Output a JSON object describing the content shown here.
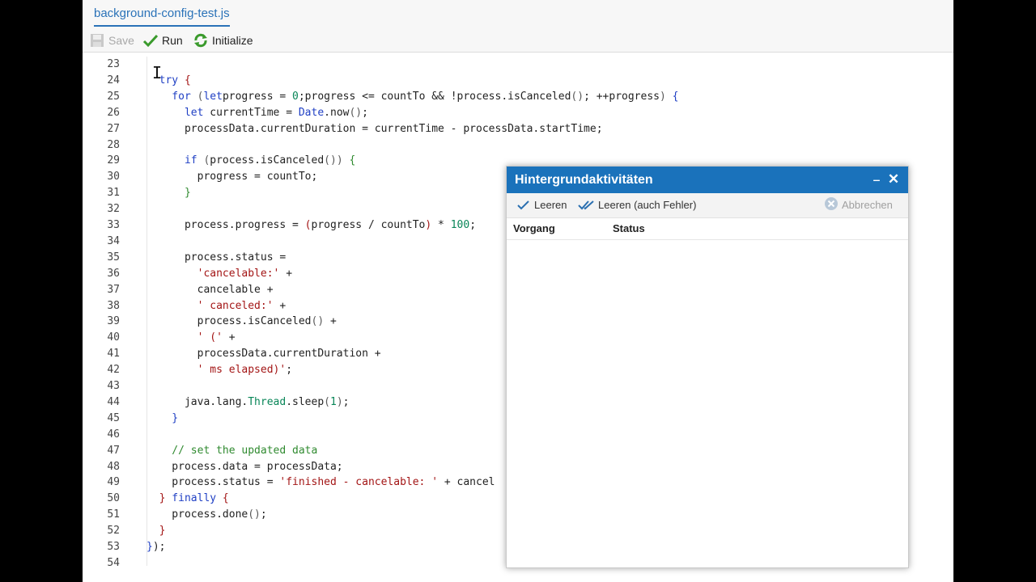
{
  "editor": {
    "tab_label": "background-config-test.js",
    "toolbar": {
      "save_label": "Save",
      "run_label": "Run",
      "initialize_label": "Initialize"
    },
    "lines": [
      {
        "no": "23",
        "segs": []
      },
      {
        "no": "24",
        "segs": [
          [
            "kw",
            "  try"
          ],
          [
            "brace",
            " {"
          ]
        ]
      },
      {
        "no": "25",
        "segs": [
          [
            "kw",
            "    for"
          ],
          [
            "pn",
            " ("
          ],
          [
            "kw",
            "let"
          ],
          [
            "",
            "progress = "
          ],
          [
            "num",
            "0"
          ],
          [
            "",
            ";progress <= countTo && !process.isCanceled"
          ],
          [
            "pn",
            "()"
          ],
          [
            "",
            "; ++progress"
          ],
          [
            "pn",
            ")"
          ],
          [
            "kw",
            " {"
          ]
        ]
      },
      {
        "no": "26",
        "segs": [
          [
            "kw",
            "      let"
          ],
          [
            "",
            " currentTime = "
          ],
          [
            "fn",
            "Date"
          ],
          [
            "",
            ".now"
          ],
          [
            "pn",
            "()"
          ],
          [
            "",
            ";"
          ]
        ]
      },
      {
        "no": "27",
        "segs": [
          [
            "",
            "      processData.currentDuration = currentTime - processData.startTime;"
          ]
        ]
      },
      {
        "no": "28",
        "segs": []
      },
      {
        "no": "29",
        "segs": [
          [
            "kw",
            "      if"
          ],
          [
            "pn",
            " ("
          ],
          [
            "",
            "process.isCanceled"
          ],
          [
            "pn",
            "()"
          ],
          [
            "pn",
            ")"
          ],
          [
            "cmt",
            " {"
          ]
        ]
      },
      {
        "no": "30",
        "segs": [
          [
            "",
            "        progress = countTo;"
          ]
        ]
      },
      {
        "no": "31",
        "segs": [
          [
            "cmt",
            "      }"
          ]
        ]
      },
      {
        "no": "32",
        "segs": []
      },
      {
        "no": "33",
        "segs": [
          [
            "",
            "      process.progress = "
          ],
          [
            "str",
            "("
          ],
          [
            "",
            "progress / countTo"
          ],
          [
            "str",
            ")"
          ],
          [
            "",
            " * "
          ],
          [
            "num",
            "100"
          ],
          [
            "",
            ";"
          ]
        ]
      },
      {
        "no": "34",
        "segs": []
      },
      {
        "no": "35",
        "segs": [
          [
            "",
            "      process.status ="
          ]
        ]
      },
      {
        "no": "36",
        "segs": [
          [
            "str",
            "        'cancelable:'"
          ],
          [
            "",
            " +"
          ]
        ]
      },
      {
        "no": "37",
        "segs": [
          [
            "",
            "        cancelable +"
          ]
        ]
      },
      {
        "no": "38",
        "segs": [
          [
            "str",
            "        ' canceled:'"
          ],
          [
            "",
            " +"
          ]
        ]
      },
      {
        "no": "39",
        "segs": [
          [
            "",
            "        process.isCanceled"
          ],
          [
            "pn",
            "()"
          ],
          [
            "",
            " +"
          ]
        ]
      },
      {
        "no": "40",
        "segs": [
          [
            "str",
            "        ' ('"
          ],
          [
            "",
            " +"
          ]
        ]
      },
      {
        "no": "41",
        "segs": [
          [
            "",
            "        processData.currentDuration +"
          ]
        ]
      },
      {
        "no": "42",
        "segs": [
          [
            "str",
            "        ' ms elapsed)'"
          ],
          [
            "",
            ";"
          ]
        ]
      },
      {
        "no": "43",
        "segs": []
      },
      {
        "no": "44",
        "segs": [
          [
            "",
            "      java.lang."
          ],
          [
            "num",
            "Thread"
          ],
          [
            "",
            ".sleep"
          ],
          [
            "pn",
            "("
          ],
          [
            "num",
            "1"
          ],
          [
            "pn",
            ")"
          ],
          [
            "",
            ";"
          ]
        ]
      },
      {
        "no": "45",
        "segs": [
          [
            "kw",
            "    }"
          ]
        ]
      },
      {
        "no": "46",
        "segs": []
      },
      {
        "no": "47",
        "segs": [
          [
            "cmt",
            "    // set the updated data"
          ]
        ]
      },
      {
        "no": "48",
        "segs": [
          [
            "",
            "    process.data = processData;"
          ]
        ]
      },
      {
        "no": "49",
        "segs": [
          [
            "",
            "    process.status = "
          ],
          [
            "str",
            "'finished - cancelable: '"
          ],
          [
            "",
            " + cancel"
          ]
        ]
      },
      {
        "no": "50",
        "segs": [
          [
            "brace",
            "  }"
          ],
          [
            "kw",
            " finally"
          ],
          [
            "brace",
            " {"
          ]
        ]
      },
      {
        "no": "51",
        "segs": [
          [
            "",
            "    process.done"
          ],
          [
            "pn",
            "()"
          ],
          [
            "",
            ";"
          ]
        ]
      },
      {
        "no": "52",
        "segs": [
          [
            "brace",
            "  }"
          ]
        ]
      },
      {
        "no": "53",
        "segs": [
          [
            "kw",
            "}"
          ],
          [
            "",
            ");"
          ]
        ]
      },
      {
        "no": "54",
        "segs": []
      }
    ]
  },
  "dialog": {
    "title": "Hintergrundaktivitäten",
    "minimize_glyph": "‒",
    "close_glyph": "✕",
    "toolbar": {
      "clear_label": "Leeren",
      "clear_all_label": "Leeren (auch Fehler)",
      "cancel_label": "Abbrechen"
    },
    "columns": {
      "process": "Vorgang",
      "status": "Status"
    }
  },
  "colors": {
    "dialog_title_bg": "#1a72bb",
    "tab_accent": "#2a72b8",
    "keyword": "#1f3fc4",
    "string": "#a31515",
    "number": "#098658",
    "comment": "#2f8a2f"
  }
}
